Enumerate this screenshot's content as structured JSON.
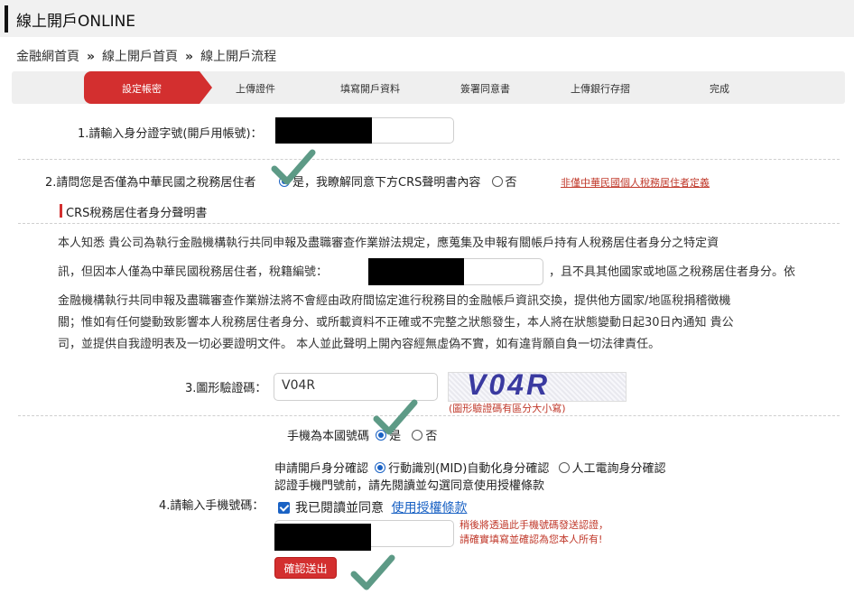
{
  "title": "線上開戶ONLINE",
  "breadcrumb": [
    "金融網首頁",
    "線上開戶首頁",
    "線上開戶流程"
  ],
  "breadcrumb_sep": "»",
  "steps": [
    "設定帳密",
    "上傳證件",
    "填寫開戶資料",
    "簽署同意書",
    "上傳銀行存摺",
    "完成"
  ],
  "q1": {
    "label": "1.請輸入身分證字號(開戶用帳號)："
  },
  "q2": {
    "label": "2.請問您是否僅為中華民國之稅務居住者",
    "yes": "是，我瞭解同意下方CRS聲明書內容",
    "no": "否",
    "link": "非僅中華民國個人稅務居住者定義"
  },
  "crs": {
    "heading": "CRS稅務居住者身分聲明書",
    "line1": "本人知悉 貴公司為執行金融機構執行共同申報及盡職審查作業辦法規定，應蒐集及申報有關帳戶持有人稅務居住者身分之特定資",
    "line2a": "訊，但因本人僅為中華民國稅務居住者，稅籍編號：",
    "line2b": "，且不具其他國家或地區之稅務居住者身分。依",
    "line3": "金融機構執行共同申報及盡職審查作業辦法將不會經由政府間協定進行稅務目的金融帳戶資訊交換，提供他方國家/地區稅捐稽徵機",
    "line4": "關；惟如有任何變動致影響本人稅務居住者身分、或所載資料不正確或不完整之狀態發生，本人將在狀態變動日起30日內通知 貴公",
    "line5": "司，並提供自我證明表及一切必要證明文件。 本人並此聲明上開內容經無虛偽不實，如有違背願自負一切法律責任。"
  },
  "q3": {
    "label": "3.圖形驗證碼：",
    "value": "V04R",
    "captcha_text": "V04R",
    "hint": "(圖形驗證碼有區分大小寫)"
  },
  "q4": {
    "label": "4.請輸入手機號碼：",
    "domestic_label": "手機為本國號碼",
    "domestic_yes": "是",
    "domestic_no": "否",
    "verify_label": "申請開戶身分確認",
    "verify_opt1": "行動識別(MID)自動化身分確認",
    "verify_opt2": "人工電詢身分確認",
    "notice": "認證手機門號前，請先閱讀並勾選同意使用授權條款",
    "agree_text": "我已閱讀並同意",
    "agree_link": "使用授權條款",
    "warn1": "稍後將透過此手機號碼發送認證，",
    "warn2": "請確實填寫並確認為您本人所有!",
    "submit": "確認送出"
  },
  "colors": {
    "accent": "#d32f2f",
    "check_overlay": "#5d9a86",
    "link_blue": "#1a62c4"
  }
}
